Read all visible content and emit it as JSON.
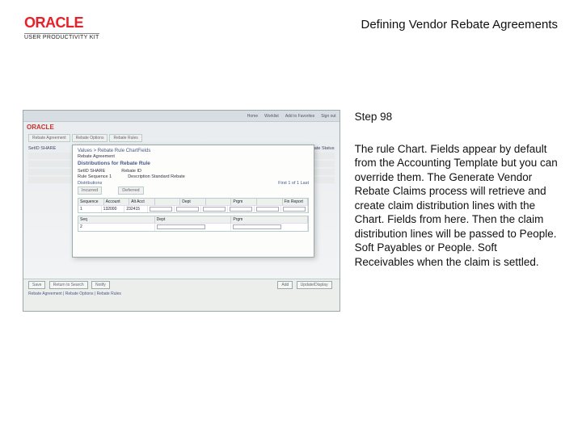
{
  "header": {
    "logo_text": "ORACLE",
    "logo_sub": "USER PRODUCTIVITY KIT",
    "doc_title": "Defining Vendor Rebate Agreements"
  },
  "right": {
    "step": "Step 98",
    "body": "The rule Chart. Fields appear by default from the Accounting Template but you can override them. The Generate Vendor Rebate Claims process will retrieve and create claim distribution lines with the Chart. Fields from here. Then the claim distribution lines will be passed to People. Soft Payables or People. Soft Receivables when the claim is settled."
  },
  "app": {
    "topbar": [
      "Home",
      "Worklist",
      "Add to Favorites",
      "Sign out"
    ],
    "oracle": "ORACLE",
    "tabs": [
      "Rebate Agreement",
      "Rebate Options",
      "Rebate Rules"
    ],
    "section_label": "SetID SHARE",
    "status_label": "Rebate Status",
    "modal": {
      "breadcrumb": "Values > Rebate Rule ChartFields",
      "subtitle": "Rebate Agreement",
      "header": "Distributions for Rebate Rule",
      "row1a": "SetID SHARE",
      "row1b": "Rebate ID",
      "row2a": "Rule Sequence 1",
      "row2b": "Description Standard Rebate",
      "distributions": "Distributions",
      "nav": "First 1 of 1 Last",
      "tab1": "Incurred",
      "tab2": "Deferred",
      "th": [
        "Sequence",
        "Account",
        "Alt Acct",
        "",
        "Dept",
        "",
        "Prgm",
        "",
        "Fin Report"
      ],
      "r1c1": "1",
      "r1c2": "132000",
      "r1c3": "232415",
      "lower_th": [
        "Seq",
        "Dept",
        "Prgm"
      ],
      "lr_seq": "2"
    },
    "footer": {
      "b1": "Save",
      "b2": "Return to Search",
      "b3": "Notify",
      "r1": "Add",
      "r2": "Update/Display",
      "line": "Rebate Agreement | Rebate Options | Rebate Rules"
    }
  }
}
